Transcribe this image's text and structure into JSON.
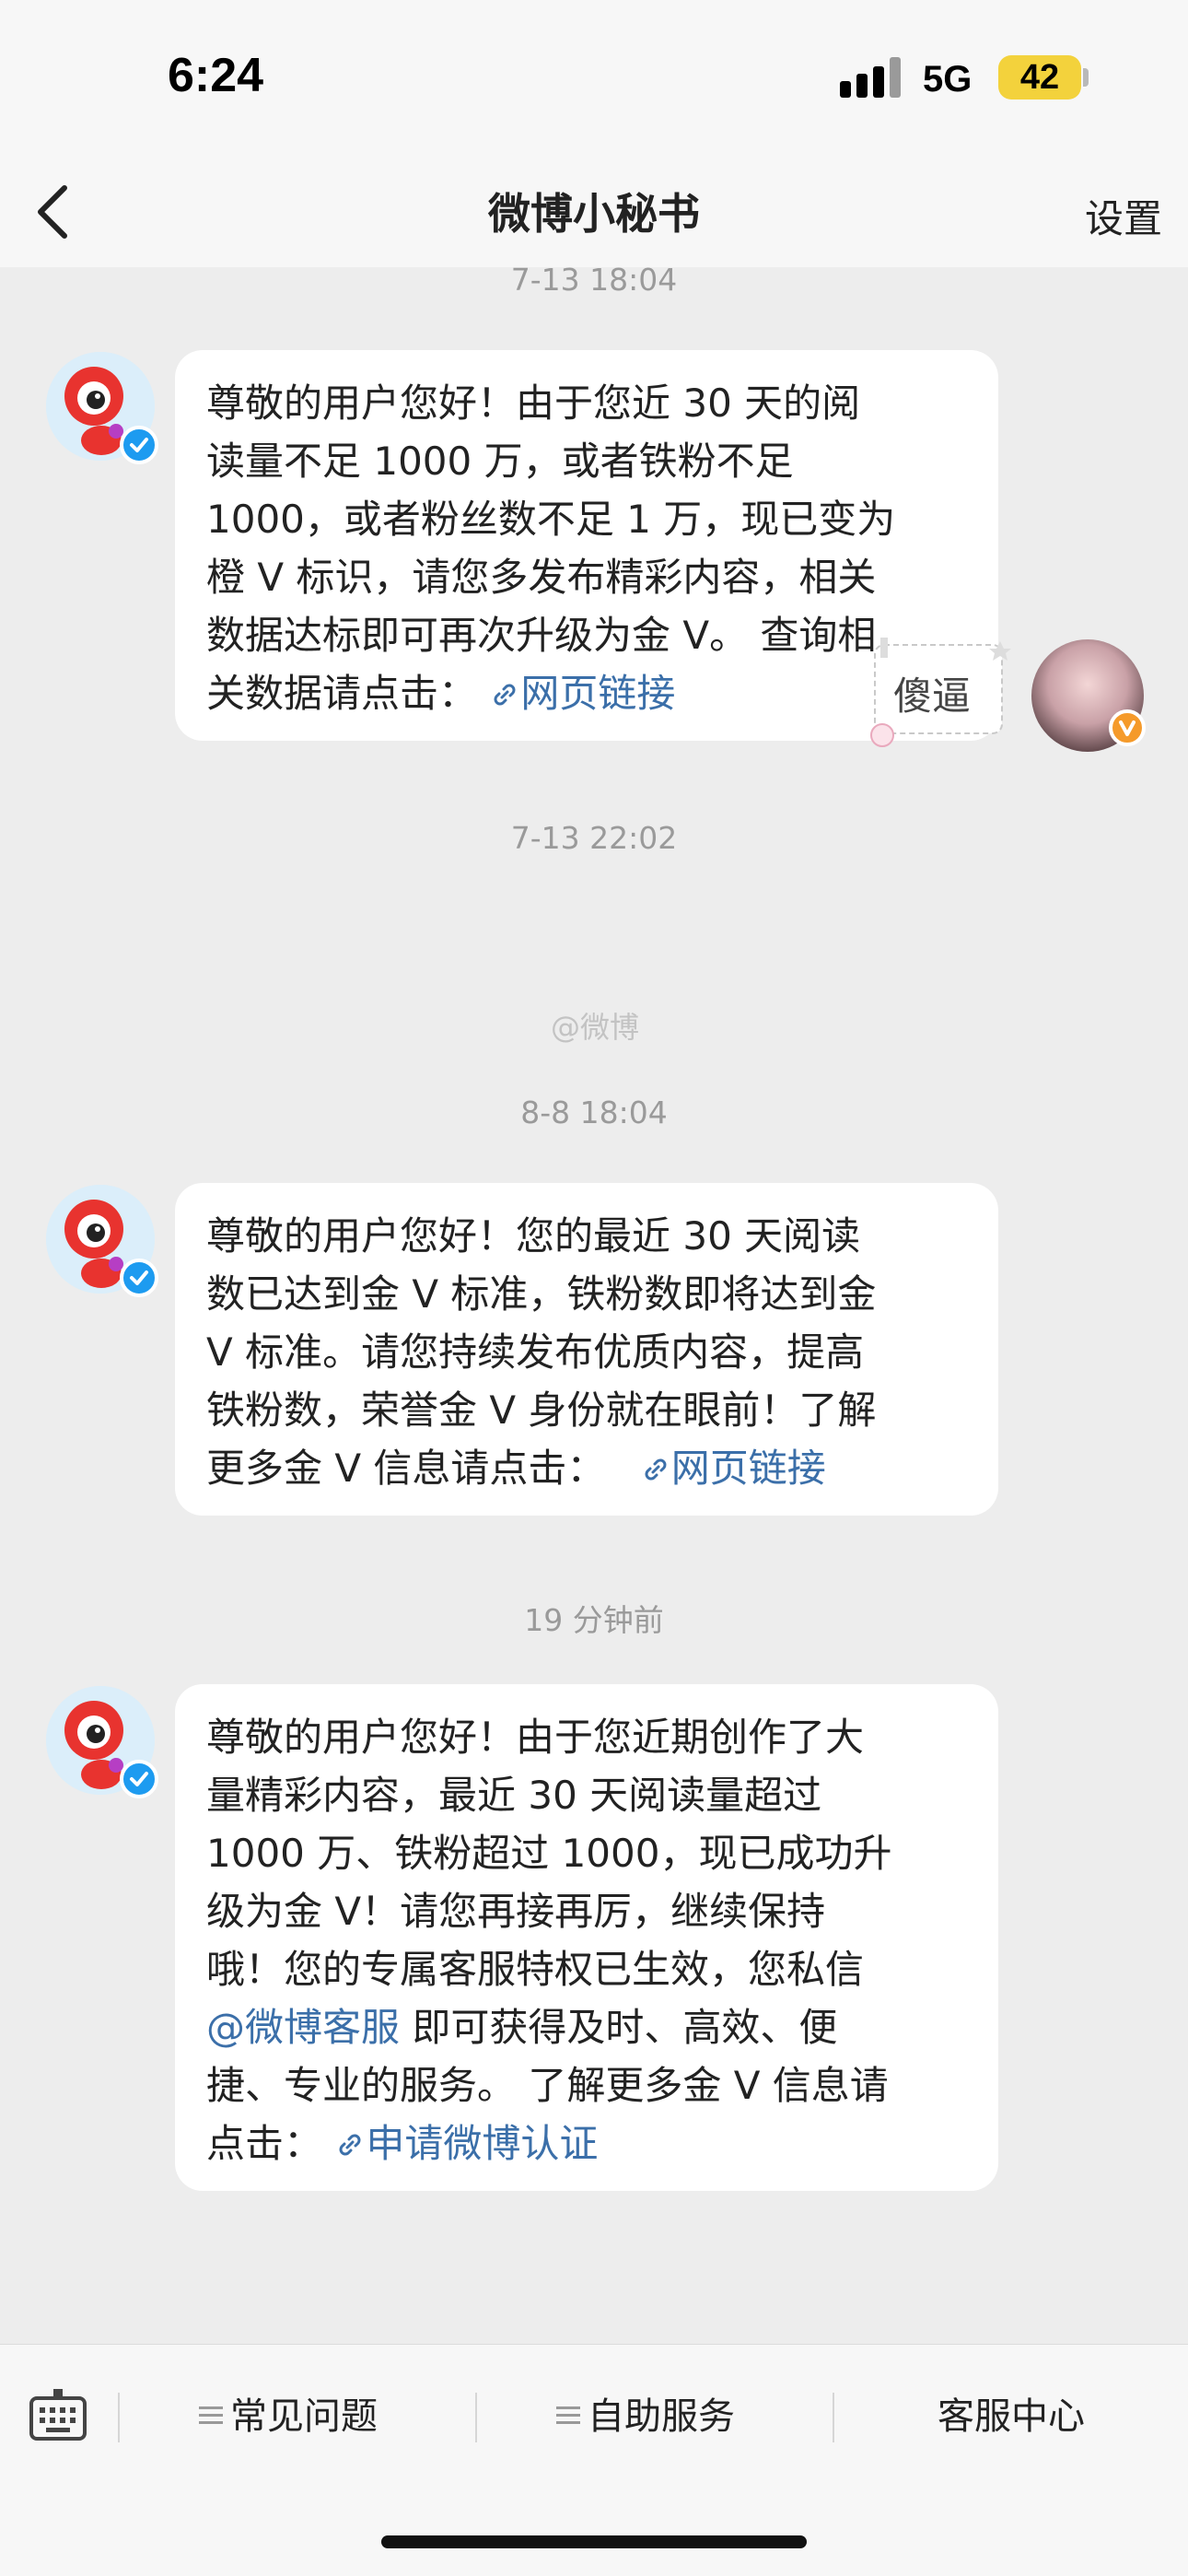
{
  "status_bar": {
    "time": "6:24",
    "network": "5G",
    "battery": "42"
  },
  "nav": {
    "title": "微博小秘书",
    "settings": "设置"
  },
  "messages": [
    {
      "timestamp": "7-13 18:04",
      "lines": [
        "尊敬的用户您好！由于您近 30 天的阅",
        "读量不足 1000 万，或者铁粉不足",
        "1000，或者粉丝数不足 1 万，现已变为",
        "橙 V 标识，请您多发布精彩内容，相关",
        "数据达标即可再次升级为金 V。 查询相",
        "关数据请点击："
      ],
      "link": "网页链接"
    },
    {
      "timestamp": "7-13 22:02",
      "sticker_text": "傻逼"
    },
    {
      "timestamp": "8-8 18:04",
      "lines": [
        "尊敬的用户您好！您的最近 30 天阅读",
        "数已达到金 V 标准，铁粉数即将达到金",
        "V 标准。请您持续发布优质内容，提高",
        "铁粉数，荣誉金 V 身份就在眼前！了解",
        "更多金 V 信息请点击："
      ],
      "link": "网页链接"
    },
    {
      "timestamp": "19 分钟前",
      "lines": [
        "尊敬的用户您好！由于您近期创作了大",
        "量精彩内容，最近 30 天阅读量超过",
        "1000 万、铁粉超过 1000，现已成功升",
        "级为金 V！请您再接再厉，继续保持",
        "哦！您的专属客服特权已生效，您私信"
      ],
      "mention": "@微博客服",
      "after_mention": " 即可获得及时、高效、便",
      "lines2": [
        "捷、专业的服务。 了解更多金 V 信息请"
      ],
      "prefix_last": "点击：",
      "link": "申请微博认证"
    }
  ],
  "watermark": "@微博",
  "toolbar": {
    "faq": "常见问题",
    "self_service": "自助服务",
    "customer_center": "客服中心"
  },
  "colors": {
    "link": "#3b6fa9",
    "background": "#ededed",
    "bubble": "#ffffff"
  }
}
